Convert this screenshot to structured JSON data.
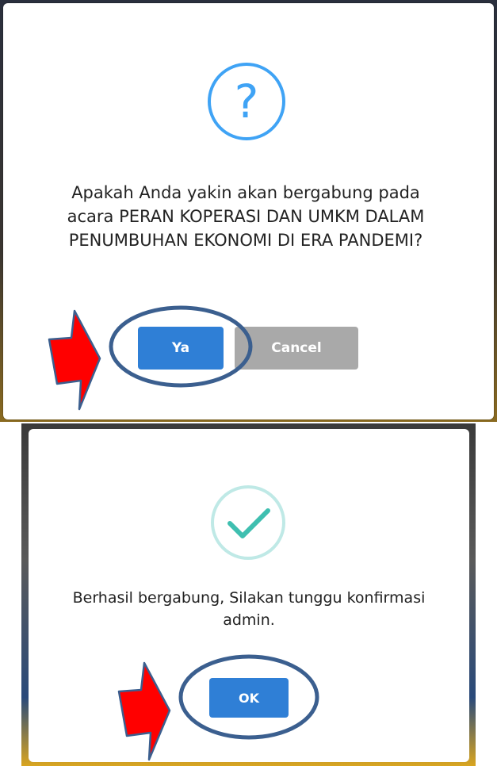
{
  "confirm_dialog": {
    "icon": "question-icon",
    "icon_glyph": "?",
    "icon_color": "#3fa3f5",
    "message": "Apakah Anda yakin akan bergabung pada acara PERAN KOPERASI DAN UMKM DALAM PENUMBUHAN EKONOMI DI ERA PANDEMI?",
    "confirm_label": "Ya",
    "cancel_label": "Cancel",
    "confirm_color": "#2f7fd6",
    "cancel_color": "#a9a9a9"
  },
  "success_dialog": {
    "icon": "checkmark-icon",
    "icon_color": "#3fbfb0",
    "message": "Berhasil bergabung, Silakan tunggu konfirmasi admin.",
    "ok_label": "OK",
    "ok_color": "#2f7fd6"
  },
  "annotations": {
    "arrow_icon": "red-arrow-icon",
    "arrow_color": "#ff0000",
    "highlight_color": "#3b5f8f"
  }
}
